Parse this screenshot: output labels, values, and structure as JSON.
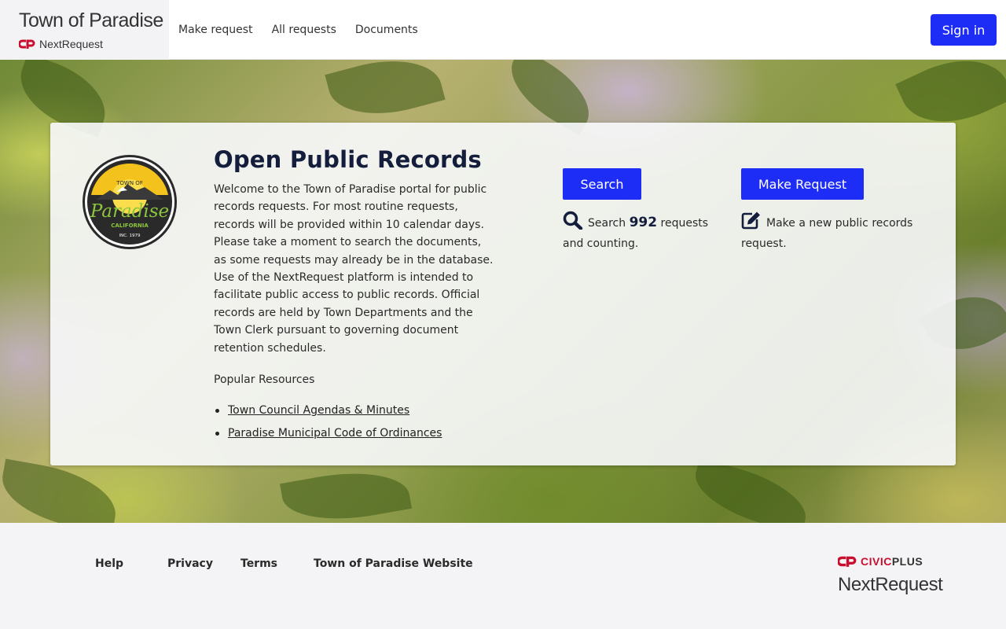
{
  "header": {
    "town_name": "Town of Paradise",
    "product_name": "NextRequest",
    "nav": [
      {
        "label": "Make request"
      },
      {
        "label": "All requests"
      },
      {
        "label": "Documents"
      }
    ],
    "sign_in_label": "Sign in"
  },
  "hero": {
    "title": "Open Public Records",
    "intro": "Welcome to the Town of Paradise portal for public records requests. For most routine requests, records will be provided within 10 calendar days. Please take a moment to search the documents, as some requests may already be in the database. Use of the NextRequest platform is intended to facilitate public access to public records. Official records are held by Town Departments and the Town Clerk pursuant to governing document retention schedules.",
    "popular_label": "Popular Resources",
    "resources": [
      {
        "label": "Town Council Agendas & Minutes"
      },
      {
        "label": "Paradise Municipal Code of Ordinances"
      }
    ],
    "seal": {
      "top": "TOWN OF",
      "name": "Paradise",
      "state": "CALIFORNIA",
      "inc": "INC. 1979"
    },
    "search": {
      "button_label": "Search",
      "prefix": "Search",
      "count": "992",
      "suffix": "requests and counting."
    },
    "make_request": {
      "button_label": "Make Request",
      "text": "Make a new public records request."
    }
  },
  "footer": {
    "links": [
      {
        "label": "Help"
      },
      {
        "label": "Privacy"
      },
      {
        "label": "Terms"
      },
      {
        "label": "Town of Paradise Website"
      }
    ],
    "vendor_civic": "CIVIC",
    "vendor_plus": "PLUS",
    "vendor_product": "NextRequest"
  },
  "colors": {
    "primary": "#1e2df5",
    "heading": "#141e3c",
    "brand_red": "#c8102e"
  },
  "icons": [
    "cp-logo-icon",
    "search-icon",
    "edit-icon"
  ]
}
